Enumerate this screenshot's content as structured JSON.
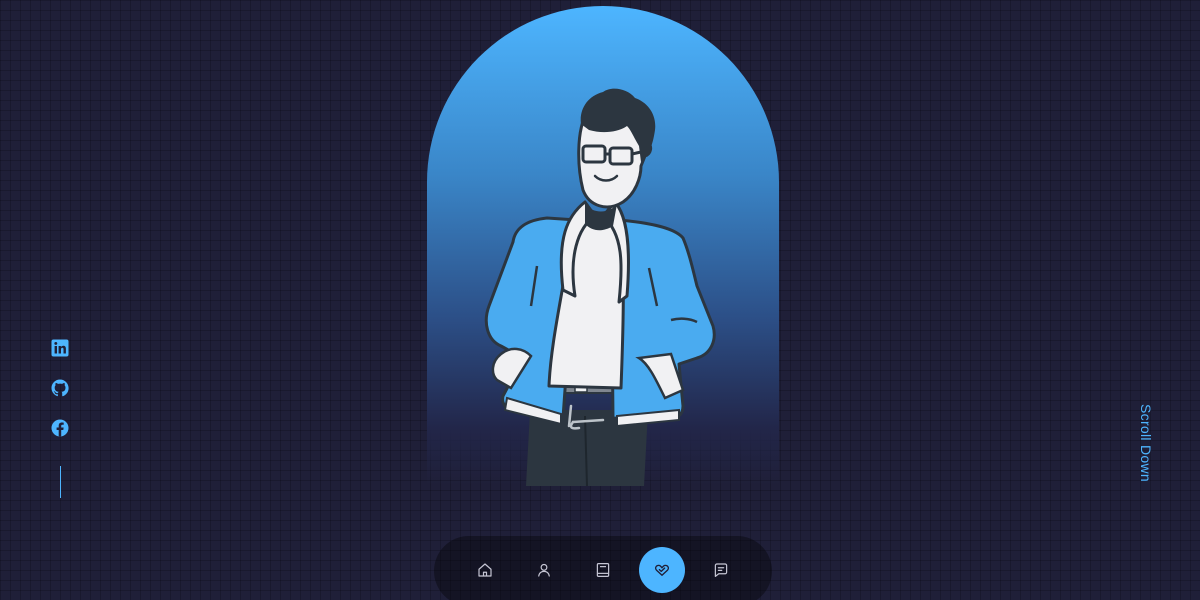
{
  "socials": {
    "items": [
      {
        "name": "linkedin",
        "icon": "linkedin-icon"
      },
      {
        "name": "github",
        "icon": "github-icon"
      },
      {
        "name": "facebook",
        "icon": "facebook-icon"
      }
    ]
  },
  "hero": {
    "avatar": "cartoon-man-illustration"
  },
  "scroll": {
    "label": "Scroll Down"
  },
  "nav": {
    "items": [
      {
        "icon": "home-icon",
        "active": false
      },
      {
        "icon": "user-icon",
        "active": false
      },
      {
        "icon": "book-icon",
        "active": false
      },
      {
        "icon": "handshake-icon",
        "active": true
      },
      {
        "icon": "message-icon",
        "active": false
      }
    ]
  },
  "colors": {
    "background": "#1f1f38",
    "accent": "#4db5ff",
    "nav_bg": "#16162b",
    "icon_inactive": "#c6c6d4"
  }
}
